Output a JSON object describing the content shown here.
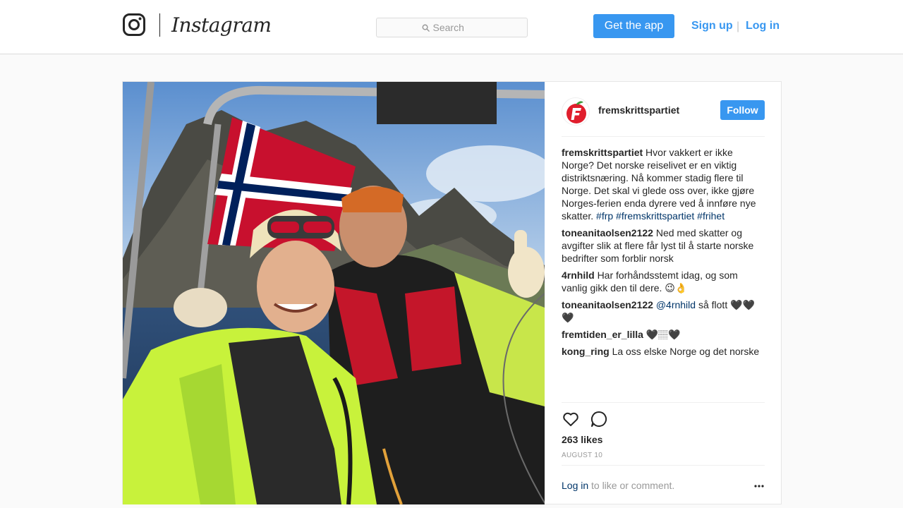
{
  "nav": {
    "wordmark": "Instagram",
    "search_placeholder": "Search",
    "get_app_label": "Get the app",
    "sign_up_label": "Sign up",
    "separator": "|",
    "log_in_label": "Log in"
  },
  "post": {
    "username": "fremskrittspartiet",
    "follow_label": "Follow",
    "comments": [
      {
        "user": "fremskrittspartiet",
        "text": "Hvor vakkert er ikke Norge? Det norske reiselivet er en viktig distriktsnæring. Nå kommer stadig flere til Norge. Det skal vi glede oss over, ikke gjøre Norges-ferien enda dyrere ved å innføre nye skatter.",
        "tags": "#frp #fremskrittspartiet #frihet"
      },
      {
        "user": "toneanitaolsen2122",
        "text": "Ned med skatter og avgifter slik at flere får lyst til å starte norske bedrifter som forblir norsk"
      },
      {
        "user": "4rnhild",
        "text": "Har forhåndsstemt idag, og som vanlig gikk den til dere. 😉👌"
      },
      {
        "user": "toneanitaolsen2122",
        "mention": "@4rnhild",
        "text": "så flott 🖤🖤🖤"
      },
      {
        "user": "fremtiden_er_lilla",
        "text": "🖤🏽🖤"
      },
      {
        "user": "kong_ring",
        "text": "La oss elske Norge og det norske"
      }
    ],
    "likes": "263 likes",
    "date": "AUGUST 10",
    "login_link": "Log in",
    "login_text": "to like or comment."
  },
  "colors": {
    "accent": "#3897f0",
    "link_dark": "#003569",
    "border": "#dbdbdb",
    "muted": "#999999"
  },
  "icons": {
    "logo": "instagram-camera-icon",
    "search": "search-icon",
    "like": "heart-icon",
    "comment": "comment-bubble-icon",
    "more": "more-options-icon"
  }
}
